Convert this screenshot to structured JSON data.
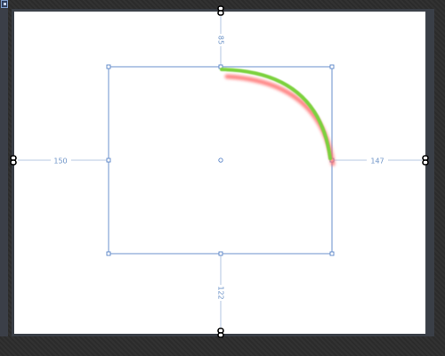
{
  "canvas": {
    "background": "#ffffff"
  },
  "selection": {
    "stroke_color": "#5b85c8"
  },
  "dimensions": {
    "top": "85",
    "left": "150",
    "right": "147",
    "bottom": "122"
  },
  "arc": {
    "stroke_color": "#7bd13c",
    "shadow_color": "#ff6e6e"
  },
  "icons": {
    "edge_handle": "chain-link-icon",
    "corner_handle": "resize-handle-icon",
    "center_handle": "pivot-point-icon"
  }
}
